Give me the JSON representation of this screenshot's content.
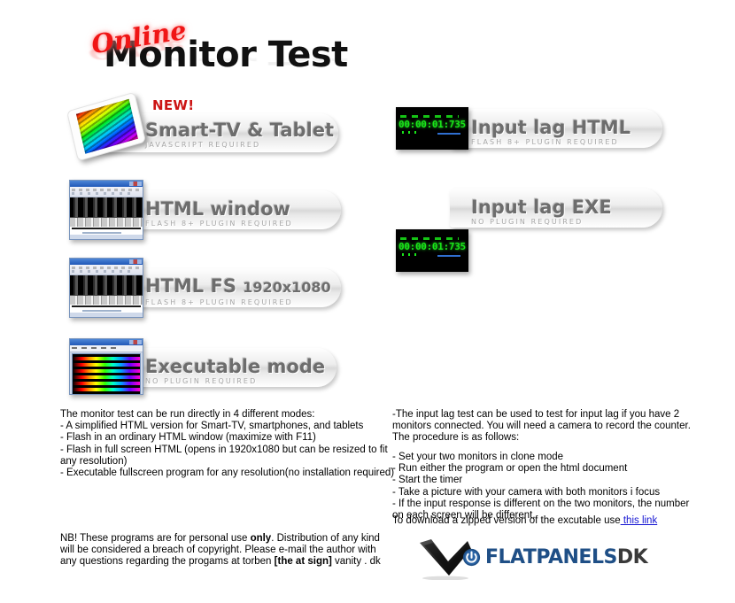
{
  "title": {
    "overlay": "Online",
    "main": "Monitor Test"
  },
  "modes": [
    {
      "id": "smart-tv-tablet",
      "badge": "NEW!",
      "label": "Smart-TV & Tablet",
      "sublabel": "JAVASCRIPT REQUIRED",
      "thumb": "tablet-rainbow-thumbnail"
    },
    {
      "id": "html-window",
      "label": "HTML window",
      "sublabel": "FLASH 8+ PLUGIN REQUIRED",
      "thumb": "browser-window-thumbnail"
    },
    {
      "id": "html-fs",
      "label": "HTML FS",
      "label_small": "1920x1080",
      "sublabel": "FLASH 8+ PLUGIN REQUIRED",
      "thumb": "browser-window-thumbnail"
    },
    {
      "id": "executable-mode",
      "label": "Executable mode",
      "sublabel": "NO PLUGIN REQUIRED",
      "thumb": "spectrum-window-thumbnail"
    }
  ],
  "lag_modes": [
    {
      "id": "input-lag-html",
      "label": "Input lag HTML",
      "sublabel": "FLASH 8+ PLUGIN REQUIRED",
      "timer": "00:00:01:735"
    },
    {
      "id": "input-lag-exe",
      "label": "Input lag EXE",
      "sublabel": "NO PLUGIN REQUIRED",
      "timer": "00:00:01:735"
    }
  ],
  "text": {
    "modes_description": "The monitor test can be run directly in 4 different modes:\n- A simplified HTML version for Smart-TV, smartphones, and tablets\n- Flash in an ordinary HTML window (maximize with F11)\n- Flash in full screen HTML (opens in 1920x1080 but can be resized to fit\nany resolution)\n- Executable fullscreen program for any resolution(no installation required)",
    "inputlag_intro": "-The input lag test can be used to test for input lag if you have 2\nmonitors connected. You will need a camera to record the counter.\nThe procedure is as follows:",
    "inputlag_steps": "- Set your two monitors in clone mode\n- Run either the program or open the html document\n- Start the timer\n- Take a picture with your camera with both monitors i focus\n- If the input response is different on the two monitors, the number\non each screen will be different.",
    "download_prefix": "To download a zipped version of the excutable use",
    "download_link": " this link",
    "nb_part1": "NB! These programs are for personal use ",
    "nb_bold1": "only",
    "nb_part2": ". Distribution of any kind\nwill be considered a breach of copyright. Please e-mail the author with\nany questions regarding the progams at torben ",
    "nb_bold2": "[the at sign]",
    "nb_part3": " vanity . dk"
  },
  "footer": {
    "logo_mark": "flatpanels-checkmark-logo",
    "power_icon": "power-icon",
    "brand_main": "FLATPANELS",
    "brand_suffix": "DK"
  },
  "colors": {
    "accent_red": "#f01515",
    "link_blue": "#1414d2",
    "brand_blue": "#1f4f86",
    "timer_green": "#19e619",
    "button_text": "#6d6d6d"
  }
}
